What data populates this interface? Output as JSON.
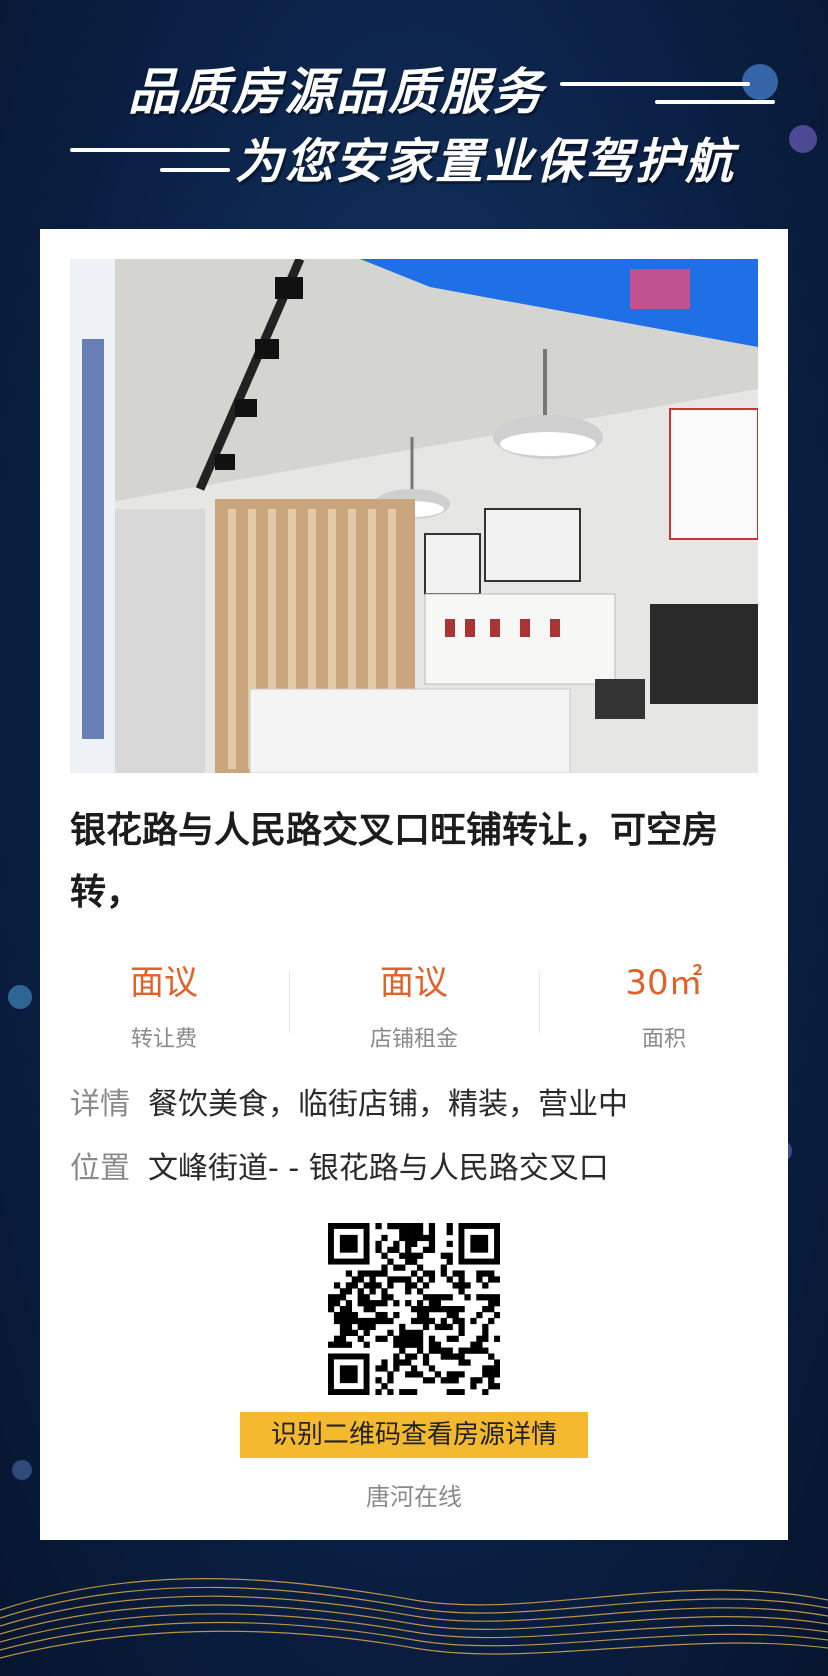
{
  "headline": {
    "line1": "品质房源品质服务",
    "line2": "为您安家置业保驾护航"
  },
  "listing": {
    "title": "银花路与人民路交叉口旺铺转让，可空房转，",
    "stats": [
      {
        "value": "面议",
        "label": "转让费"
      },
      {
        "value": "面议",
        "label": "店铺租金"
      },
      {
        "value": "30㎡",
        "label": "面积"
      }
    ],
    "details_key": "详情",
    "details_value": "餐饮美食，临街店铺，精装，营业中",
    "location_key": "位置",
    "location_value": "文峰街道- - 银花路与人民路交叉口"
  },
  "qr": {
    "caption": "识别二维码查看房源详情"
  },
  "footer": {
    "source": "唐河在线"
  },
  "colors": {
    "accent": "#e0622a",
    "caption_bg": "#f5b92f",
    "background": "#0b2147"
  }
}
